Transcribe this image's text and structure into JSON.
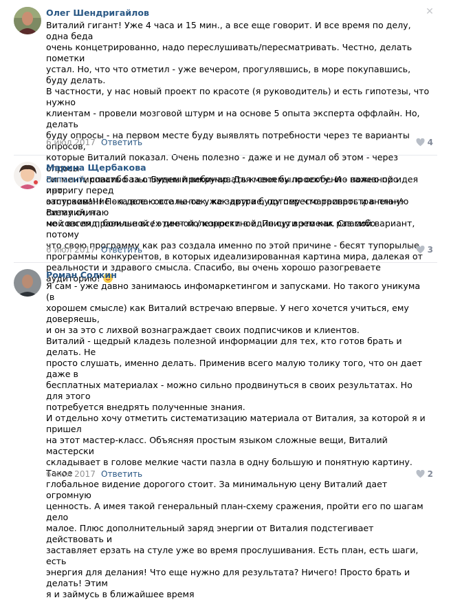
{
  "comments": [
    {
      "author": "Олег Шендригайлов",
      "lines": [
        "Виталий гигант! Уже 4 часа и 15 мин., а все еще говорит. И все время по делу, одна беда",
        "очень концетрированно, надо переслушивать/пересматривать. Честно, делать пометки",
        "устал. Но, что что отметил - уже вечером, прогулявшись, в море покупавшись, буду делать.",
        "В частности, у нас новый проект по красоте (я руководитель) и есть гипотезы, что нужно",
        "клиентам - провели мозговой штурм и на основе 5 опыта эксперта оффлайн. Но, делать",
        "буду опросы - на первом месте буду выявлять потребности через те варианты опросов,",
        "которые Виталий показал. Очень полезно - даже и не думал об этом - через опросы",
        "сигментировать базы. Будем прикручивать к своему проекту. И - важно про интригу перед",
        "запуском!!!! Пока все - остальное уже завтра буду пересматривать и в план! Виталий, на",
        "мой взгляд, больше всех дает полезности в единицу времени. Спасибо"
      ],
      "date": "6 июл 2017",
      "reply": "Ответить",
      "likes": "4"
    },
    {
      "author": "Марина Щербакова",
      "mention": "Виталий",
      "lines": [
        ", спасибо за отличный вебинар. Для меня было особенно полезной идея про",
        "отстраивание - я делаю все не так, как другие, потому что распространенную схему считаю",
        "не совсем правильной / этичной / корректной. По сути это как раз мой вариант, потому",
        "что свою программу как раз создала именно по этой причине - бесят тупорылые",
        "программы конкурентов, в которых идеализированная картина мира, далекая от",
        "реальности и здравого смысла. Спасибо, вы очень хорошо разогреваете аудиторию!"
      ],
      "date": "6 июл 2017",
      "reply": "Ответить",
      "likes": "3"
    },
    {
      "author": "Роман Солкин",
      "lines": [
        "Я сам - уже давно занимаюсь инфомаркетингом и запусками. Но такого уникума (в",
        "хорошем смысле) как Виталий встречаю впервые. У него хочется учиться, ему доверяешь,",
        "и он за это с лихвой вознаграждает своих подписчиков и клиентов.",
        "Виталий - щедрый кладезь полезной информации для тех, кто готов брать и делать. Не",
        "просто слушать, именно делать. Применив всего малую толику того, что он дает даже в",
        "бесплатных материалах - можно сильно продвинуться в своих результатах. Но для этого",
        "потребуется внедрять полученные знания.",
        "И отдельно хочу отметить систематизацию материала от Виталия, за которой я и пришел",
        "на этот мастер-класс. Объясняя простым языком сложные вещи, Виталий мастерски",
        "складывает в голове мелкие части пазла в одну большую и понятную картину. Такое",
        "глобальное видение дорогого стоит. За минимальную цену Виталий дает огромную",
        "ценность. А имея такой генеральный план-схему сражения, пройти его по шагам дело",
        "малое. Плюс дополнительный заряд энергии от Виталия подстегивает действовать и",
        "заставляет ерзать на стуле уже во время прослушивания. Есть план, есть шаги, есть",
        "энергия для делания! Что еще нужно для результата? Ничего! Просто брать и делать! Этим",
        "я и займусь в ближайшее время"
      ],
      "date": "6 июл 2017",
      "reply": "Ответить",
      "likes": "2"
    }
  ],
  "icons": {
    "close": "close-icon",
    "like": "heart-icon",
    "emoji": "wink-emoji-icon"
  },
  "colors": {
    "link": "#2a5885",
    "meta": "#939393",
    "divider": "#e7e8ec"
  }
}
